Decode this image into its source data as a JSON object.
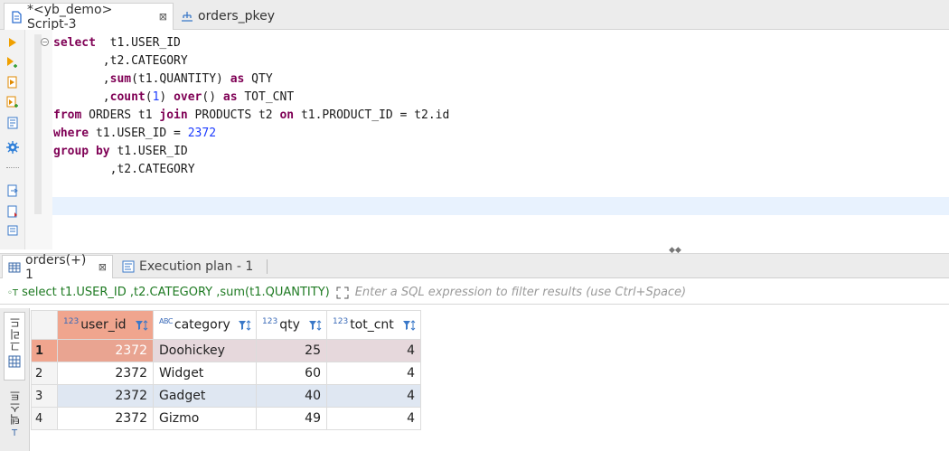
{
  "editor_tabs": [
    {
      "label": "*<yb_demo> Script-3",
      "close": "⊠"
    },
    {
      "label": "orders_pkey"
    }
  ],
  "sql_lines": [
    [
      {
        "t": "select",
        "k": "kw"
      },
      {
        "t": "  t1.USER_ID"
      }
    ],
    [
      {
        "t": "       ,t2.CATEGORY"
      }
    ],
    [
      {
        "t": "       ,"
      },
      {
        "t": "sum",
        "k": "kw"
      },
      {
        "t": "(t1.QUANTITY) "
      },
      {
        "t": "as",
        "k": "kw"
      },
      {
        "t": " QTY"
      }
    ],
    [
      {
        "t": "       ,"
      },
      {
        "t": "count",
        "k": "kw"
      },
      {
        "t": "("
      },
      {
        "t": "1",
        "k": "num"
      },
      {
        "t": ") "
      },
      {
        "t": "over",
        "k": "kw"
      },
      {
        "t": "() "
      },
      {
        "t": "as",
        "k": "kw"
      },
      {
        "t": " TOT_CNT"
      }
    ],
    [
      {
        "t": "from",
        "k": "kw"
      },
      {
        "t": " ORDERS t1 "
      },
      {
        "t": "join",
        "k": "kw"
      },
      {
        "t": " PRODUCTS t2 "
      },
      {
        "t": "on",
        "k": "kw"
      },
      {
        "t": " t1.PRODUCT_ID = t2.id"
      }
    ],
    [
      {
        "t": "where",
        "k": "kw"
      },
      {
        "t": " t1.USER_ID = "
      },
      {
        "t": "2372",
        "k": "num"
      }
    ],
    [
      {
        "t": "group by",
        "k": "kw"
      },
      {
        "t": " t1.USER_ID"
      }
    ],
    [
      {
        "t": "        ,t2.CATEGORY"
      }
    ]
  ],
  "result_tabs": [
    {
      "label": "orders(+) 1",
      "close": "⊠"
    },
    {
      "label": "Execution plan - 1"
    }
  ],
  "filter": {
    "query": "select t1.USER_ID ,t2.CATEGORY ,sum(t1.QUANTITY)",
    "placeholder": "Enter a SQL expression to filter results (use Ctrl+Space)"
  },
  "side_tabs": {
    "grid": "그리드",
    "text": "텍스트"
  },
  "grid": {
    "columns": [
      {
        "type": "123",
        "name": "user_id"
      },
      {
        "type": "ABC",
        "name": "category"
      },
      {
        "type": "123",
        "name": "qty"
      },
      {
        "type": "123",
        "name": "tot_cnt"
      }
    ],
    "rows": [
      {
        "rn": "1",
        "user_id": "2372",
        "category": "Doohickey",
        "qty": "25",
        "tot_cnt": "4"
      },
      {
        "rn": "2",
        "user_id": "2372",
        "category": "Widget",
        "qty": "60",
        "tot_cnt": "4"
      },
      {
        "rn": "3",
        "user_id": "2372",
        "category": "Gadget",
        "qty": "40",
        "tot_cnt": "4"
      },
      {
        "rn": "4",
        "user_id": "2372",
        "category": "Gizmo",
        "qty": "49",
        "tot_cnt": "4"
      }
    ]
  },
  "colors": {
    "keyword": "#7f0055",
    "number": "#1d3cff",
    "selected_cell": "#e9a491",
    "filter_text": "#1e7a22"
  }
}
